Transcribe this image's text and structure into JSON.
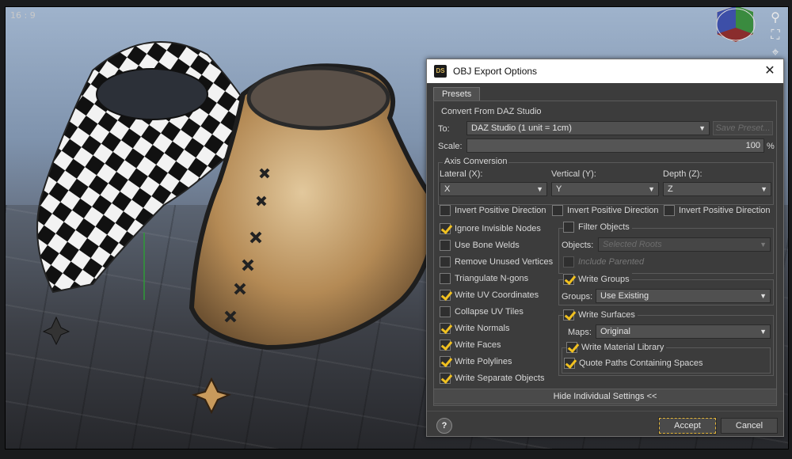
{
  "viewport": {
    "aspect_label": "16 : 9",
    "nav_tools": [
      "zoom-icon",
      "frame-icon",
      "perspective-icon"
    ]
  },
  "dialog": {
    "title": "OBJ Export Options",
    "app_icon": "DS",
    "close_glyph": "✕",
    "tab": "Presets",
    "convert": {
      "group_label": "Convert From DAZ Studio",
      "to_label": "To:",
      "to_value": "DAZ Studio (1 unit = 1cm)",
      "save_preset": "Save Preset...",
      "scale_label": "Scale:",
      "scale_value": "100",
      "scale_unit": "%"
    },
    "axis": {
      "group_label": "Axis Conversion",
      "lateral_label": "Lateral (X):",
      "lateral_value": "X",
      "vertical_label": "Vertical (Y):",
      "vertical_value": "Y",
      "depth_label": "Depth (Z):",
      "depth_value": "Z",
      "invert_label": "Invert Positive Direction"
    },
    "options": [
      {
        "label": "Ignore Invisible Nodes",
        "checked": true
      },
      {
        "label": "Use Bone Welds",
        "checked": false
      },
      {
        "label": "Remove Unused Vertices",
        "checked": false
      },
      {
        "label": "Triangulate N-gons",
        "checked": false
      },
      {
        "label": "Write UV Coordinates",
        "checked": true
      },
      {
        "label": "Collapse UV Tiles",
        "checked": false
      },
      {
        "label": "Write Normals",
        "checked": true
      },
      {
        "label": "Write Faces",
        "checked": true
      },
      {
        "label": "Write Polylines",
        "checked": true
      },
      {
        "label": "Write Separate Objects",
        "checked": true
      }
    ],
    "filter": {
      "label": "Filter Objects",
      "objects_label": "Objects:",
      "objects_value": "Selected Roots",
      "include_parented": "Include Parented"
    },
    "groups": {
      "label": "Write Groups",
      "groups_label": "Groups:",
      "groups_value": "Use Existing"
    },
    "surfaces": {
      "label": "Write Surfaces",
      "maps_label": "Maps:",
      "maps_value": "Original",
      "material_library": "Write Material Library",
      "quote_paths": "Quote Paths Containing Spaces"
    },
    "hide_settings": "Hide Individual Settings <<",
    "help": "?",
    "accept": "Accept",
    "cancel": "Cancel"
  }
}
